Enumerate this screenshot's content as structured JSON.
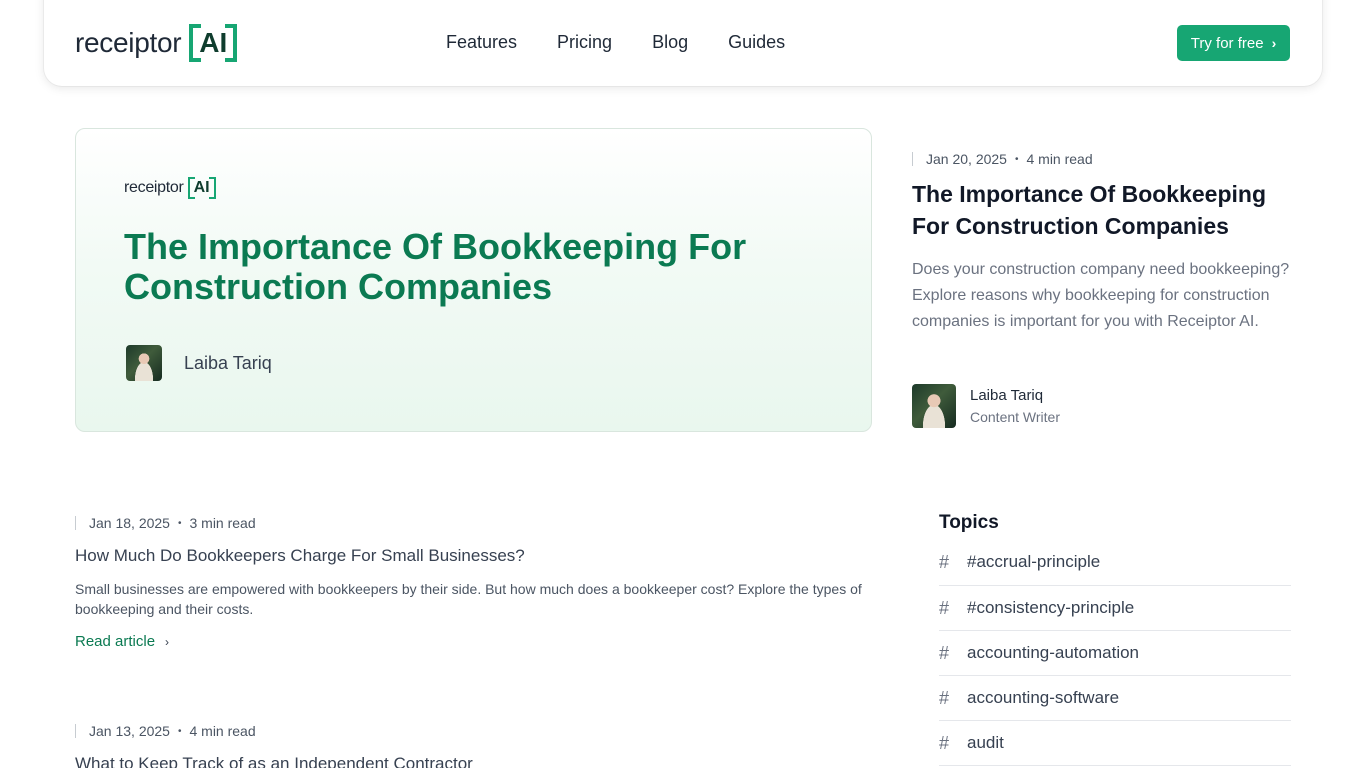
{
  "header": {
    "logo_word": "receiptor",
    "logo_ai": "AI",
    "nav": [
      "Features",
      "Pricing",
      "Blog",
      "Guides"
    ],
    "cta_label": "Try for free"
  },
  "hero": {
    "logo_word": "receiptor",
    "logo_ai": "AI",
    "title": "The Importance Of Bookkeeping For Construction Companies",
    "author": "Laiba Tariq"
  },
  "featured": {
    "date": "Jan 20, 2025",
    "read_time": "4 min read",
    "title": "The Importance Of Bookkeeping For Construction Companies",
    "description": "Does your construction company need bookkeeping? Explore reasons why bookkeeping for construction companies is important for you with Receiptor AI.",
    "author_name": "Laiba Tariq",
    "author_role": "Content Writer"
  },
  "articles": [
    {
      "date": "Jan 18, 2025",
      "read_time": "3 min read",
      "title": "How Much Do Bookkeepers Charge For Small Businesses?",
      "description": "Small businesses are empowered with bookkeepers by their side. But how much does a bookkeeper cost? Explore the types of bookkeeping and their costs.",
      "read_label": "Read article"
    },
    {
      "date": "Jan 13, 2025",
      "read_time": "4 min read",
      "title": "What to Keep Track of as an Independent Contractor"
    }
  ],
  "topics": {
    "heading": "Topics",
    "items": [
      "#accrual-principle",
      "#consistency-principle",
      "accounting-automation",
      "accounting-software",
      "audit"
    ]
  },
  "colors": {
    "brand_green": "#17a673",
    "title_green": "#0b7a52"
  }
}
